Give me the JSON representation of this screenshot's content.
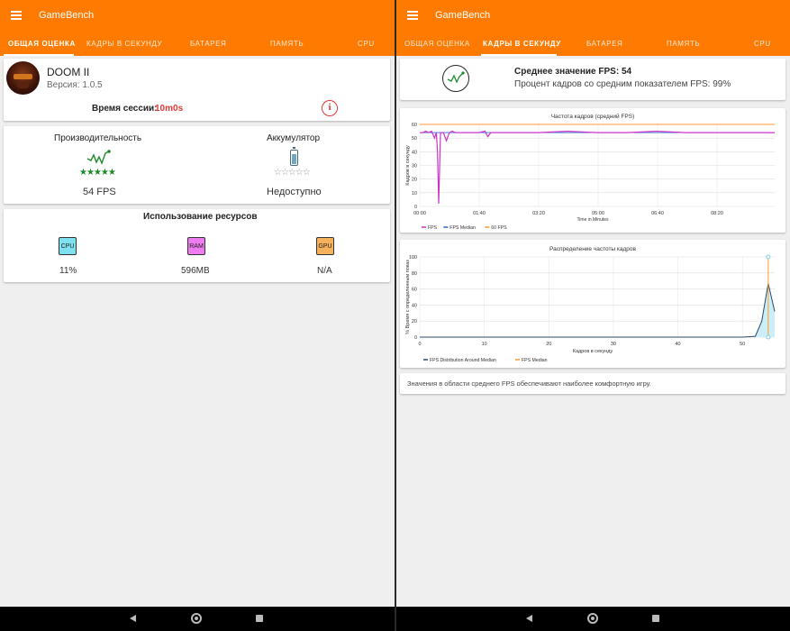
{
  "app_title": "GameBench",
  "tabs": [
    "ОБЩАЯ ОЦЕНКА",
    "КАДРЫ В СЕКУНДУ",
    "БАТАРЕЯ",
    "ПАМЯТЬ",
    "CPU"
  ],
  "left": {
    "game": {
      "name": "DOOM II",
      "version": "Версия: 1.0.5",
      "session_label": "Время сессии:",
      "session_value": "10m0s"
    },
    "performance": {
      "title": "Производительность",
      "value": "54 FPS",
      "stars": 5
    },
    "battery": {
      "title": "Аккумулятор",
      "value": "Недоступно",
      "stars": 0
    },
    "resources": {
      "title": "Использование ресурсов",
      "items": [
        {
          "chip": "CPU",
          "value": "11%",
          "color": "#7fe0f0"
        },
        {
          "chip": "RAM",
          "value": "596MB",
          "color": "#ee7cf0"
        },
        {
          "chip": "GPU",
          "value": "N/A",
          "color": "#f6b15d"
        }
      ]
    }
  },
  "right": {
    "summary": {
      "avg_fps": "Среднее значение FPS: 54",
      "pct": "Процент кадров со средним показателем FPS: 99%"
    },
    "chart1": {
      "title": "Частота кадров (средний FPS)",
      "ylabel": "Кадров в секунду",
      "xlabel": "Time in Minutes",
      "yticks": [
        "60",
        "50",
        "40",
        "30",
        "20",
        "10",
        "0"
      ],
      "xticks": [
        "00:00",
        "01:40",
        "03:20",
        "05:00",
        "06:40",
        "08:20"
      ],
      "legend": [
        "FPS",
        "FPS Median",
        "60 FPS"
      ]
    },
    "chart2": {
      "title": "Распределение частоты кадров",
      "ylabel": "% Время с определенным показ",
      "xlabel": "Кадров в секунду",
      "yticks": [
        "100",
        "80",
        "60",
        "40",
        "20",
        "0"
      ],
      "xticks": [
        "0",
        "10",
        "20",
        "30",
        "40",
        "50"
      ],
      "legend": [
        "FPS Distribution Around Median",
        "FPS Median"
      ]
    },
    "note": "Значения в области среднего FPS обеспечивают наиболее комфортную игру."
  },
  "chart_data": [
    {
      "type": "line",
      "title": "Частота кадров (средний FPS)",
      "xlabel": "Time in Minutes",
      "ylabel": "Кадров в секунду",
      "ylim": [
        0,
        60
      ],
      "x_seconds_range": [
        0,
        600
      ],
      "series": [
        {
          "name": "FPS",
          "color": "#cc33cc",
          "x": [
            0,
            5,
            10,
            15,
            20,
            25,
            28,
            30,
            32,
            35,
            40,
            45,
            50,
            55,
            60,
            80,
            100,
            110,
            115,
            120,
            150,
            200,
            250,
            300,
            350,
            400,
            450,
            500,
            550,
            600
          ],
          "y": [
            54,
            54,
            55,
            54,
            55,
            50,
            54,
            40,
            2,
            54,
            54,
            48,
            54,
            55,
            54,
            54,
            54,
            55,
            51,
            54,
            54,
            54,
            55,
            54,
            54,
            55,
            54,
            54,
            54,
            54
          ]
        },
        {
          "name": "FPS Median",
          "color": "#3366cc",
          "x": [
            0,
            600
          ],
          "y": [
            54,
            54
          ]
        },
        {
          "name": "60 FPS",
          "color": "#ff9933",
          "x": [
            0,
            600
          ],
          "y": [
            60,
            60
          ]
        }
      ]
    },
    {
      "type": "area",
      "title": "Распределение частоты кадров",
      "xlabel": "Кадров в секунду",
      "ylabel": "% Время с определенным показ",
      "ylim": [
        0,
        100
      ],
      "xlim": [
        0,
        55
      ],
      "series": [
        {
          "name": "FPS Distribution Around Median",
          "color": "#2c4a6e",
          "x": [
            0,
            5,
            10,
            15,
            20,
            25,
            30,
            35,
            40,
            45,
            50,
            52,
            53,
            54,
            55
          ],
          "y": [
            0,
            0,
            0,
            0,
            0,
            0,
            0,
            0,
            0,
            0,
            0,
            1,
            20,
            67,
            32
          ]
        },
        {
          "name": "FPS Median",
          "color": "#ff9933",
          "x": [
            54,
            54
          ],
          "y": [
            0,
            100
          ]
        }
      ]
    }
  ]
}
